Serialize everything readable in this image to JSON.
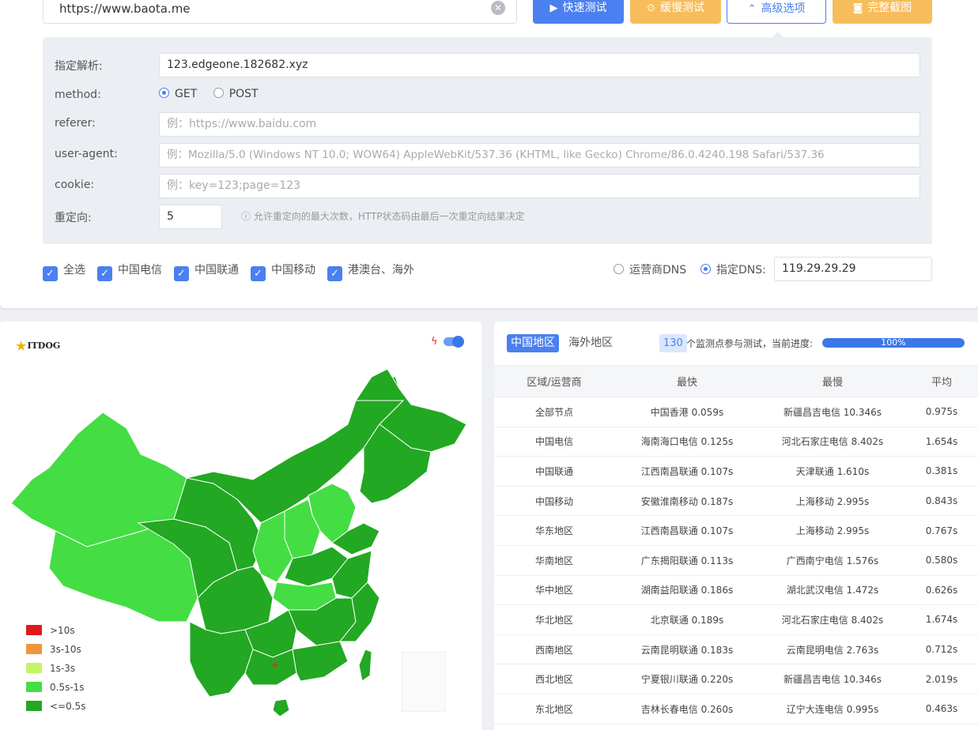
{
  "top": {
    "url_value": "https://www.baota.me",
    "buttons": {
      "fast": "快速测试",
      "slow": "缓慢测试",
      "advanced": "高级选项",
      "screenshot": "完整截图"
    }
  },
  "advanced": {
    "resolve_label": "指定解析:",
    "resolve_value": "123.edgeone.182682.xyz",
    "method_label": "method:",
    "method_options": [
      "GET",
      "POST"
    ],
    "method_selected": "GET",
    "referer_label": "referer:",
    "referer_placeholder": "例：https://www.baidu.com",
    "ua_label": "user-agent:",
    "ua_placeholder": "例：Mozilla/5.0 (Windows NT 10.0; WOW64) AppleWebKit/537.36 (KHTML, like Gecko) Chrome/86.0.4240.198 Safari/537.36",
    "cookie_label": "cookie:",
    "cookie_placeholder": "例：key=123;page=123",
    "redirect_label": "重定向:",
    "redirect_value": "5",
    "redirect_hint": "允许重定向的最大次数，HTTP状态码由最后一次重定向结果决定"
  },
  "filters": {
    "checkboxes": [
      "全选",
      "中国电信",
      "中国联通",
      "中国移动",
      "港澳台、海外"
    ],
    "dns_isp_label": "运营商DNS",
    "dns_custom_label": "指定DNS:",
    "dns_value": "119.29.29.29"
  },
  "map": {
    "logo_text": "ITDOG",
    "legend": [
      {
        "label": ">10s",
        "color": "#e0191b"
      },
      {
        "label": "3s-10s",
        "color": "#f0963a"
      },
      {
        "label": "1s-3s",
        "color": "#c2f56a"
      },
      {
        "label": "0.5s-1s",
        "color": "#44dd44"
      },
      {
        "label": "<=0.5s",
        "color": "#22a822"
      }
    ]
  },
  "results": {
    "tabs": [
      "中国地区",
      "海外地区"
    ],
    "count": "130",
    "count_text": "个监测点参与测试，当前进度:",
    "progress_label": "100%",
    "progress_value": 1.0,
    "columns": [
      "区域/运营商",
      "最快",
      "最慢",
      "平均"
    ],
    "rows": [
      [
        "全部节点",
        "中国香港 0.059s",
        "新疆昌吉电信 10.346s",
        "0.975s"
      ],
      [
        "中国电信",
        "海南海口电信 0.125s",
        "河北石家庄电信 8.402s",
        "1.654s"
      ],
      [
        "中国联通",
        "江西南昌联通 0.107s",
        "天津联通 1.610s",
        "0.381s"
      ],
      [
        "中国移动",
        "安徽淮南移动 0.187s",
        "上海移动 2.995s",
        "0.843s"
      ],
      [
        "华东地区",
        "江西南昌联通 0.107s",
        "上海移动 2.995s",
        "0.767s"
      ],
      [
        "华南地区",
        "广东揭阳联通 0.113s",
        "广西南宁电信 1.576s",
        "0.580s"
      ],
      [
        "华中地区",
        "湖南益阳联通 0.186s",
        "湖北武汉电信 1.472s",
        "0.626s"
      ],
      [
        "华北地区",
        "北京联通 0.189s",
        "河北石家庄电信 8.402s",
        "1.674s"
      ],
      [
        "西南地区",
        "云南昆明联通 0.183s",
        "云南昆明电信 2.763s",
        "0.712s"
      ],
      [
        "西北地区",
        "宁夏银川联通 0.220s",
        "新疆昌吉电信 10.346s",
        "2.019s"
      ],
      [
        "东北地区",
        "吉林长春电信 0.260s",
        "辽宁大连电信 0.995s",
        "0.463s"
      ]
    ]
  }
}
